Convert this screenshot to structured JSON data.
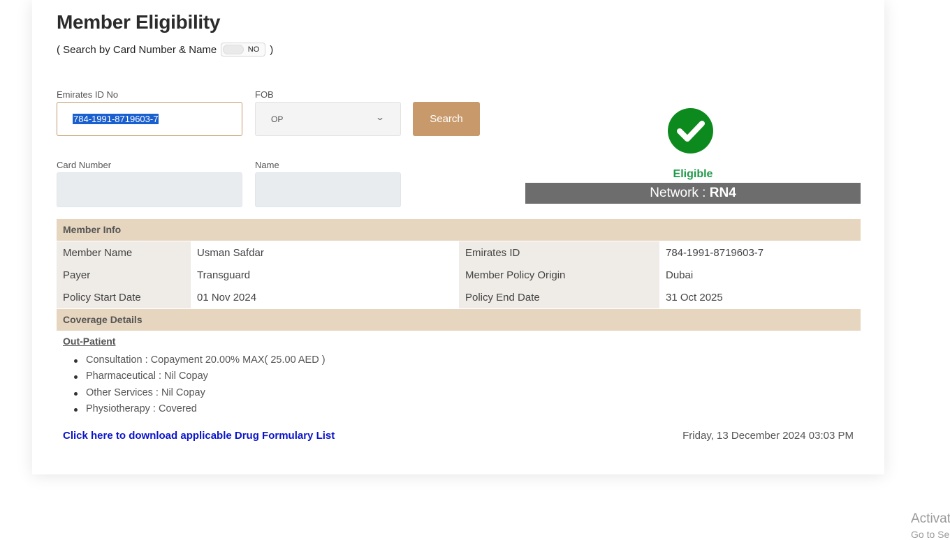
{
  "page": {
    "title": "Member Eligibility"
  },
  "search_toggle": {
    "prefix": "( Search by Card Number & Name",
    "state": "NO",
    "suffix": ")"
  },
  "form": {
    "emirates_id": {
      "label": "Emirates ID No",
      "value": "784-1991-8719603-7"
    },
    "fob": {
      "label": "FOB",
      "value": "OP"
    },
    "search_button": "Search",
    "card_number": {
      "label": "Card Number",
      "value": ""
    },
    "name": {
      "label": "Name",
      "value": ""
    }
  },
  "eligibility": {
    "status": "Eligible",
    "network_label": "Network :",
    "network_value": "RN4",
    "status_color": "#1f9a47"
  },
  "member_info": {
    "header": "Member Info",
    "rows": [
      {
        "k1": "Member Name",
        "v1": "Usman Safdar",
        "k2": "Emirates ID",
        "v2": "784-1991-8719603-7"
      },
      {
        "k1": "Payer",
        "v1": "Transguard",
        "k2": "Member Policy Origin",
        "v2": "Dubai"
      },
      {
        "k1": "Policy Start Date",
        "v1": "01 Nov 2024",
        "k2": "Policy End Date",
        "v2": "31 Oct 2025"
      }
    ]
  },
  "coverage": {
    "header": "Coverage Details",
    "section_title": "Out-Patient",
    "items": [
      "Consultation : Copayment 20.00% MAX( 25.00 AED )",
      "Pharmaceutical : Nil Copay",
      "Other Services : Nil Copay",
      "Physiotherapy : Covered"
    ]
  },
  "footer": {
    "drug_link": "Click here to download applicable Drug Formulary List",
    "timestamp": "Friday, 13 December 2024 03:03 PM"
  },
  "os_watermark": {
    "line1": "Activat",
    "line2": "Go to Se"
  },
  "colors": {
    "accent": "#c8996a",
    "section_bg": "#e7d6bf",
    "network_bg": "#6d6d6d",
    "link": "#0a14c8"
  }
}
